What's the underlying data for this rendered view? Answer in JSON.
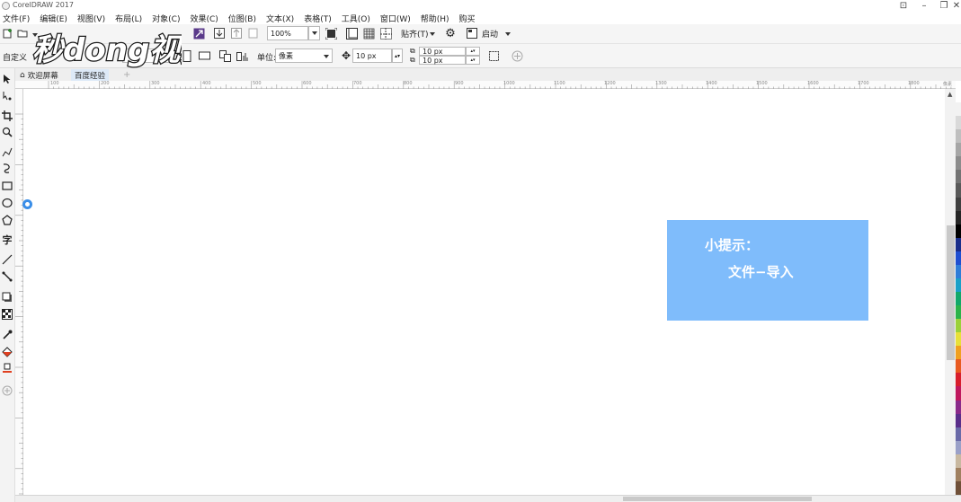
{
  "window": {
    "title": "CorelDRAW 2017",
    "controls": [
      "minimize",
      "restore",
      "close"
    ]
  },
  "menu": [
    "文件(F)",
    "编辑(E)",
    "视图(V)",
    "布局(L)",
    "对象(C)",
    "效果(C)",
    "位图(B)",
    "文本(X)",
    "表格(T)",
    "工具(O)",
    "窗口(W)",
    "帮助(H)",
    "购买"
  ],
  "toolbar": {
    "zoom": "100%",
    "snap_label": "贴齐(T)",
    "launch_label": "启动"
  },
  "property_bar": {
    "preset": "自定义",
    "unit_label": "单位:",
    "unit_value": "像素",
    "nudge": "10 px",
    "dup_x": "10 px",
    "dup_y": "10 px"
  },
  "tabs": [
    "欢迎屏幕",
    "百度经验"
  ],
  "ruler_labels": [
    "100",
    "200",
    "300",
    "400",
    "500",
    "600",
    "700",
    "800",
    "900",
    "1000",
    "1100",
    "1200",
    "1300",
    "1400",
    "1500",
    "1600",
    "1700",
    "1800"
  ],
  "ruler_unit": "像素",
  "watermark": {
    "text": "秒dong视频"
  },
  "tip": {
    "title": "小提示：",
    "body": "文件−导入",
    "color": "#7fbcfb"
  },
  "palette_colors": [
    "#ffffff",
    "#f2f2f2",
    "#d9d9d9",
    "#bfbfbf",
    "#a6a6a6",
    "#8c8c8c",
    "#737373",
    "#595959",
    "#404040",
    "#262626",
    "#000000",
    "#1a2e8a",
    "#1f4fd1",
    "#2f7dd8",
    "#1aa0c8",
    "#12a86a",
    "#2cb34a",
    "#9bd13a",
    "#e8e03a",
    "#f0a020",
    "#e85a20",
    "#d81e2c",
    "#c0185e",
    "#8a2a8a",
    "#5a2e8a",
    "#6a6aa8",
    "#9aa0c8",
    "#c8b8a0",
    "#a08060",
    "#705038"
  ]
}
